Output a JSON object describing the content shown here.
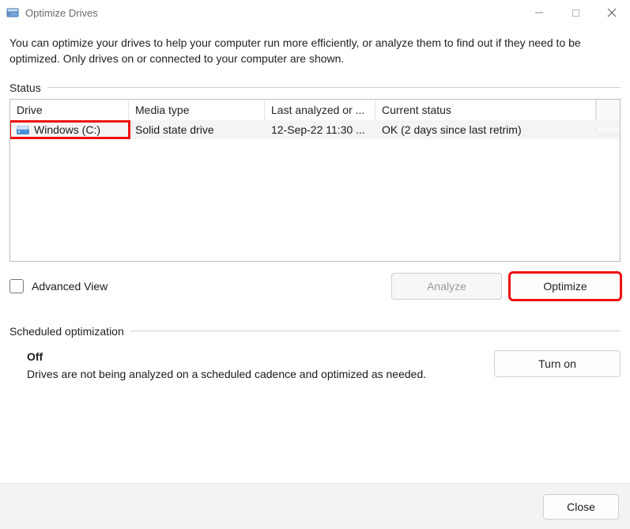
{
  "window": {
    "title": "Optimize Drives"
  },
  "description": "You can optimize your drives to help your computer run more efficiently, or analyze them to find out if they need to be optimized. Only drives on or connected to your computer are shown.",
  "status_section_label": "Status",
  "columns": {
    "drive": "Drive",
    "media": "Media type",
    "last": "Last analyzed or ...",
    "status": "Current status"
  },
  "drives": [
    {
      "name": "Windows (C:)",
      "media": "Solid state drive",
      "last": "12-Sep-22 11:30 ...",
      "status": "OK (2 days since last retrim)"
    }
  ],
  "advanced_view_label": "Advanced View",
  "buttons": {
    "analyze": "Analyze",
    "optimize": "Optimize",
    "turn_on": "Turn on",
    "close": "Close"
  },
  "schedule": {
    "section_label": "Scheduled optimization",
    "state": "Off",
    "detail": "Drives are not being analyzed on a scheduled cadence and optimized as needed."
  }
}
